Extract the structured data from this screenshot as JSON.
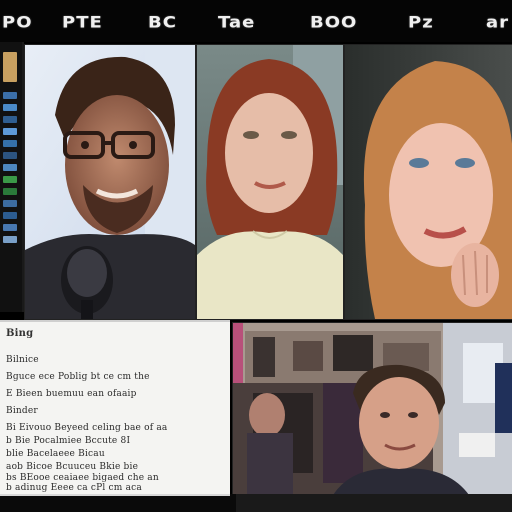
{
  "top_bar": {
    "labels": [
      "PO",
      "PTE",
      "BC",
      "Tae",
      "BOO",
      "Pz",
      "ar"
    ]
  },
  "tiles": [
    {
      "name": "video-tile-1"
    },
    {
      "name": "video-tile-2"
    },
    {
      "name": "video-tile-3"
    },
    {
      "name": "video-tile-4"
    }
  ],
  "chat": {
    "title": "Bing",
    "lines": [
      "Bilnice",
      "Bguce ece Poblig bt ce cm  the",
      "E Bieen buemuu ean ofaaip",
      "Binder",
      "Bi  Eivouo Beyeed celing bae of aa",
      "b  Bie  Pocalmiee Bccute 8I",
      "blie  Bacelaeee Bicau",
      "aob  Bicoe Bcuuceu  Bkie bie",
      "bs  BEooe ceaiaee bigaed che an",
      "b  adinug  Eeee  ca  cPl  cm aca"
    ]
  },
  "colors": {
    "background": "#000000",
    "chat_bg": "#f4f4f2",
    "label": "#f0f0f0"
  }
}
